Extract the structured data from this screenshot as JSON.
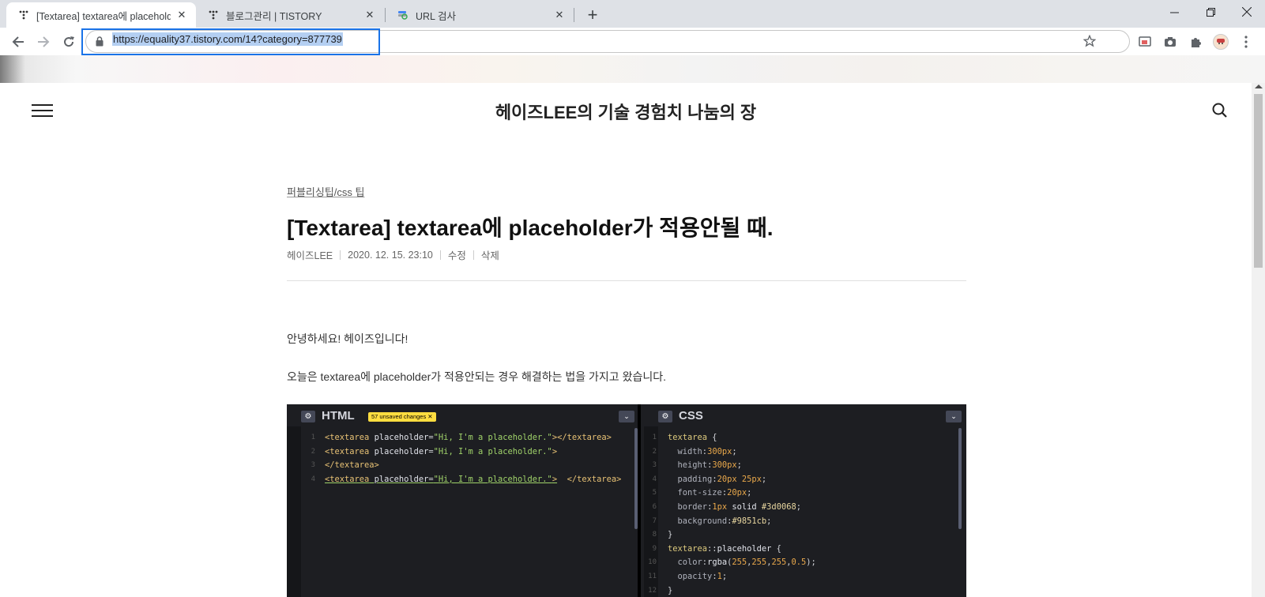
{
  "browser": {
    "tabs": [
      {
        "title": "[Textarea] textarea에 placeholder",
        "active": true
      },
      {
        "title": "블로그관리 | TISTORY",
        "active": false
      },
      {
        "title": "URL 검사",
        "active": false
      }
    ],
    "url": "https://equality37.tistory.com/14?category=877739"
  },
  "page": {
    "site_title": "헤이즈LEE의 기술 경험치 나눔의 장",
    "category": "퍼블리싱팁/css 팁",
    "post_title": "[Textarea] textarea에 placeholder가 적용안될 때.",
    "meta": {
      "author": "헤이즈LEE",
      "date": "2020. 12. 15. 23:10",
      "edit": "수정",
      "delete": "삭제"
    },
    "paragraphs": [
      "안녕하세요! 헤이즈입니다!",
      "오늘은 textarea에 placeholder가 적용안되는 경우 해결하는 법을 가지고 왔습니다."
    ],
    "code_image": {
      "html_label": "HTML",
      "badge": "57 unsaved changes ✕",
      "css_label": "CSS"
    }
  }
}
